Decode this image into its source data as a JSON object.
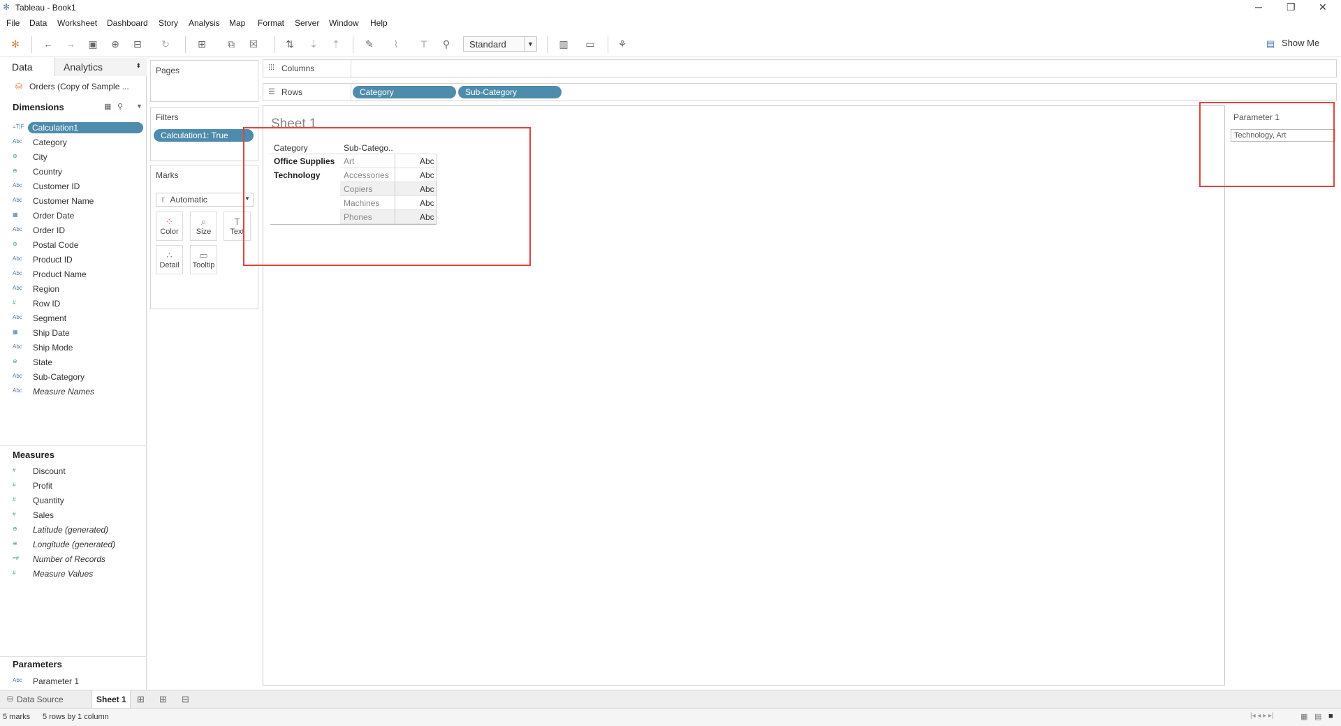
{
  "window": {
    "title": "Tableau - Book1"
  },
  "menu": [
    "File",
    "Data",
    "Worksheet",
    "Dashboard",
    "Story",
    "Analysis",
    "Map",
    "Format",
    "Server",
    "Window",
    "Help"
  ],
  "toolbar": {
    "fit_select": "Standard",
    "show_me": "Show Me"
  },
  "left_pane": {
    "tabs": {
      "data": "Data",
      "analytics": "Analytics"
    },
    "datasource": "Orders (Copy of Sample ...",
    "dimensions_header": "Dimensions",
    "dimensions": [
      {
        "icon": "=T|F",
        "label": "Calculation1"
      },
      {
        "icon": "Abc",
        "label": "Category"
      },
      {
        "icon": "globe",
        "label": "City"
      },
      {
        "icon": "globe",
        "label": "Country"
      },
      {
        "icon": "Abc",
        "label": "Customer ID"
      },
      {
        "icon": "Abc",
        "label": "Customer Name"
      },
      {
        "icon": "calendar",
        "label": "Order Date"
      },
      {
        "icon": "Abc",
        "label": "Order ID"
      },
      {
        "icon": "globe",
        "label": "Postal Code"
      },
      {
        "icon": "Abc",
        "label": "Product ID"
      },
      {
        "icon": "Abc",
        "label": "Product Name"
      },
      {
        "icon": "Abc",
        "label": "Region"
      },
      {
        "icon": "#",
        "label": "Row ID"
      },
      {
        "icon": "Abc",
        "label": "Segment"
      },
      {
        "icon": "calendar",
        "label": "Ship Date"
      },
      {
        "icon": "Abc",
        "label": "Ship Mode"
      },
      {
        "icon": "globe",
        "label": "State"
      },
      {
        "icon": "Abc",
        "label": "Sub-Category"
      },
      {
        "icon": "Abc",
        "label": "Measure Names"
      }
    ],
    "measures_header": "Measures",
    "measures": [
      {
        "icon": "#",
        "label": "Discount"
      },
      {
        "icon": "#",
        "label": "Profit"
      },
      {
        "icon": "#",
        "label": "Quantity"
      },
      {
        "icon": "#",
        "label": "Sales"
      },
      {
        "icon": "globe",
        "label": "Latitude (generated)"
      },
      {
        "icon": "globe",
        "label": "Longitude (generated)"
      },
      {
        "icon": "=#",
        "label": "Number of Records"
      },
      {
        "icon": "#",
        "label": "Measure Values"
      }
    ],
    "parameters_header": "Parameters",
    "parameters": [
      {
        "icon": "Abc",
        "label": "Parameter 1"
      }
    ]
  },
  "cards": {
    "pages": "Pages",
    "filters": "Filters",
    "filter_pill": "Calculation1: True",
    "marks": "Marks",
    "mark_type": "Automatic",
    "mark_buttons": [
      "Color",
      "Size",
      "Text",
      "Detail",
      "Tooltip"
    ]
  },
  "shelves": {
    "columns": "Columns",
    "rows": "Rows",
    "row_pills": [
      "Category",
      "Sub-Category"
    ]
  },
  "view": {
    "sheet_title": "Sheet 1",
    "headers": [
      "Category",
      "Sub-Catego.."
    ],
    "groups": [
      {
        "category": "Office Supplies",
        "subs": [
          "Art"
        ]
      },
      {
        "category": "Technology",
        "subs": [
          "Accessories",
          "Copiers",
          "Machines",
          "Phones"
        ]
      }
    ],
    "cell_text": "Abc"
  },
  "parameter_card": {
    "label": "Parameter 1",
    "value": "Technology, Art"
  },
  "sheet_tabs": {
    "data_source": "Data Source",
    "sheet": "Sheet 1"
  },
  "status": {
    "marks": "5 marks",
    "dims": "5 rows by 1 column"
  },
  "colors": {
    "pill": "#4e8cad",
    "highlight": "#e0443e"
  }
}
